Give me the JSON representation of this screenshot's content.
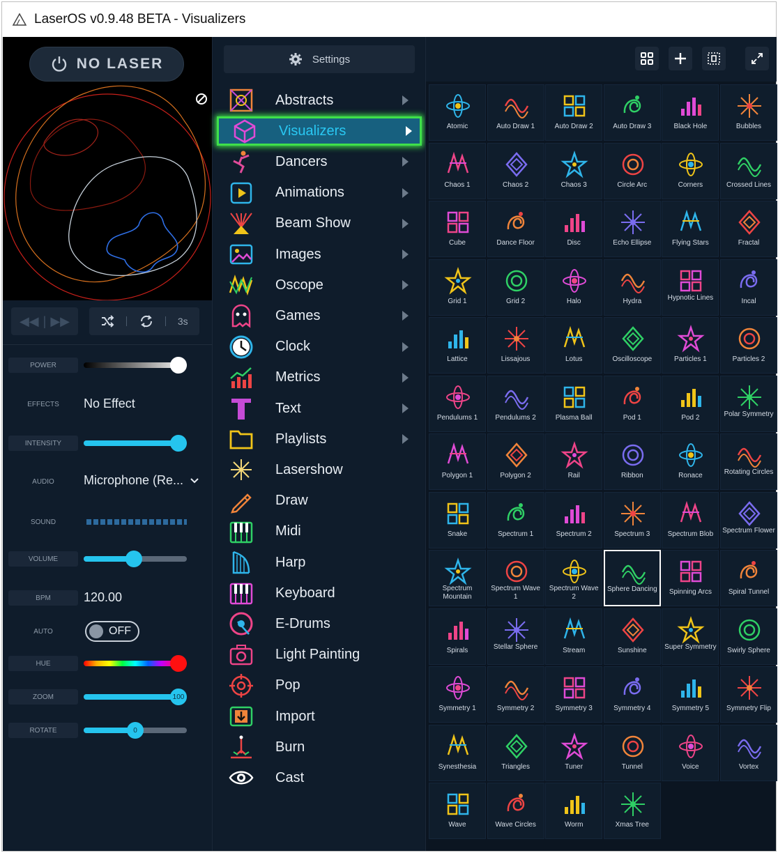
{
  "window": {
    "title": "LaserOS v0.9.48 BETA - Visualizers"
  },
  "left": {
    "laser_button": "NO LASER",
    "transport": {
      "timer": "3s"
    },
    "controls": {
      "power": {
        "label": "POWER",
        "value": 0.92
      },
      "effects": {
        "label": "EFFECTS",
        "value": "No Effect"
      },
      "intensity": {
        "label": "INTENSITY",
        "value": 0.92
      },
      "audio": {
        "label": "AUDIO",
        "value": "Microphone (Re..."
      },
      "sound": {
        "label": "SOUND"
      },
      "volume": {
        "label": "VOLUME",
        "value": 0.48
      },
      "bpm": {
        "label": "BPM",
        "value": "120.00"
      },
      "auto": {
        "label": "AUTO",
        "value": "OFF"
      },
      "hue": {
        "label": "HUE",
        "value": 0.92
      },
      "zoom": {
        "label": "ZOOM",
        "value": "100"
      },
      "rotate": {
        "label": "ROTATE",
        "value": "0"
      }
    }
  },
  "middle": {
    "settings_label": "Settings",
    "menu": [
      {
        "label": "Abstracts",
        "icon": "abstracts-icon",
        "arrow": true
      },
      {
        "label": "Visualizers",
        "icon": "visualizers-icon",
        "arrow": true,
        "active": true
      },
      {
        "label": "Dancers",
        "icon": "dancers-icon",
        "arrow": true
      },
      {
        "label": "Animations",
        "icon": "animations-icon",
        "arrow": true
      },
      {
        "label": "Beam Show",
        "icon": "beam-show-icon",
        "arrow": true
      },
      {
        "label": "Images",
        "icon": "images-icon",
        "arrow": true
      },
      {
        "label": "Oscope",
        "icon": "oscope-icon",
        "arrow": true
      },
      {
        "label": "Games",
        "icon": "games-icon",
        "arrow": true
      },
      {
        "label": "Clock",
        "icon": "clock-icon",
        "arrow": true
      },
      {
        "label": "Metrics",
        "icon": "metrics-icon",
        "arrow": true
      },
      {
        "label": "Text",
        "icon": "text-icon",
        "arrow": true
      },
      {
        "label": "Playlists",
        "icon": "playlists-icon",
        "arrow": true
      },
      {
        "label": "Lasershow",
        "icon": "lasershow-icon",
        "arrow": false
      },
      {
        "label": "Draw",
        "icon": "draw-icon",
        "arrow": false
      },
      {
        "label": "Midi",
        "icon": "midi-icon",
        "arrow": false
      },
      {
        "label": "Harp",
        "icon": "harp-icon",
        "arrow": false
      },
      {
        "label": "Keyboard",
        "icon": "keyboard-icon",
        "arrow": false
      },
      {
        "label": "E-Drums",
        "icon": "e-drums-icon",
        "arrow": false
      },
      {
        "label": "Light Painting",
        "icon": "light-painting-icon",
        "arrow": false
      },
      {
        "label": "Pop",
        "icon": "pop-icon",
        "arrow": false
      },
      {
        "label": "Import",
        "icon": "import-icon",
        "arrow": false
      },
      {
        "label": "Burn",
        "icon": "burn-icon",
        "arrow": false
      },
      {
        "label": "Cast",
        "icon": "cast-icon",
        "arrow": false
      }
    ]
  },
  "right": {
    "toolbar": [
      "grid-view-icon",
      "add-icon",
      "select-icon",
      "fullscreen-icon"
    ],
    "tiles": [
      "Atomic",
      "Auto Draw 1",
      "Auto Draw 2",
      "Auto Draw 3",
      "Black Hole",
      "Bubbles",
      "Chaos 1",
      "Chaos 2",
      "Chaos 3",
      "Circle Arc",
      "Corners",
      "Crossed Lines",
      "Cube",
      "Dance Floor",
      "Disc",
      "Echo Ellipse",
      "Flying Stars",
      "Fractal",
      "Grid 1",
      "Grid 2",
      "Halo",
      "Hydra",
      "Hypnotic Lines",
      "Incal",
      "Lattice",
      "Lissajous",
      "Lotus",
      "Oscilloscope",
      "Particles 1",
      "Particles 2",
      "Pendulums 1",
      "Pendulums 2",
      "Plasma Ball",
      "Pod 1",
      "Pod 2",
      "Polar Symmetry",
      "Polygon 1",
      "Polygon 2",
      "Rail",
      "Ribbon",
      "Ronace",
      "Rotating Circles",
      "Snake",
      "Spectrum 1",
      "Spectrum 2",
      "Spectrum 3",
      "Spectrum Blob",
      "Spectrum Flower",
      "Spectrum Mountain",
      "Spectrum Wave 1",
      "Spectrum Wave 2",
      "Sphere Dancing",
      "Spinning Arcs",
      "Spiral Tunnel",
      "Spirals",
      "Stellar Sphere",
      "Stream",
      "Sunshine",
      "Super Symmetry",
      "Swirly Sphere",
      "Symmetry 1",
      "Symmetry 2",
      "Symmetry 3",
      "Symmetry 4",
      "Symmetry 5",
      "Symmetry Flip",
      "Synesthesia",
      "Triangles",
      "Tuner",
      "Tunnel",
      "Voice",
      "Vortex",
      "Wave",
      "Wave Circles",
      "Worm",
      "Xmas Tree"
    ],
    "selected": "Sphere Dancing"
  },
  "colors": {
    "accent": "#25c4ee",
    "highlight": "#3fe04a",
    "background": "#0e1b2a"
  }
}
